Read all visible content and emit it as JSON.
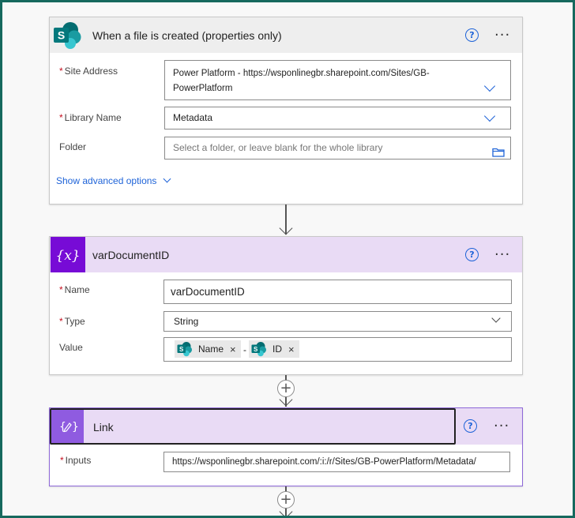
{
  "trigger": {
    "title": "When a file is created (properties only)",
    "icon": "sharepoint-icon",
    "site_address_label": "Site Address",
    "site_address_line1": "Power Platform - https://wsponlinegbr.sharepoint.com/Sites/GB-",
    "site_address_line2": "PowerPlatform",
    "library_label": "Library Name",
    "library_value": "Metadata",
    "folder_label": "Folder",
    "folder_placeholder": "Select a folder, or leave blank for the whole library",
    "advanced_link": "Show advanced options"
  },
  "variable": {
    "title": "varDocumentID",
    "icon": "variable-icon",
    "name_label": "Name",
    "name_value": "varDocumentID",
    "type_label": "Type",
    "type_value": "String",
    "value_label": "Value",
    "token1": "Name",
    "separator": "-",
    "token2": "ID"
  },
  "link_step": {
    "title": "Link",
    "icon": "variable-edit-icon",
    "inputs_label": "Inputs",
    "inputs_value": "https://wsponlinegbr.sharepoint.com/:i:/r/Sites/GB-PowerPlatform/Metadata/"
  },
  "common": {
    "help_glyph": "?",
    "more_glyph": "···",
    "required_mark": "*",
    "plus_glyph": "+",
    "token_remove": "×"
  },
  "colors": {
    "sharepoint": "#038387",
    "variable": "#770bd6",
    "header_trigger": "#eeeeee",
    "header_variable": "#e9dbf5",
    "link_blue": "#1e63d8",
    "frame": "#16695e"
  }
}
